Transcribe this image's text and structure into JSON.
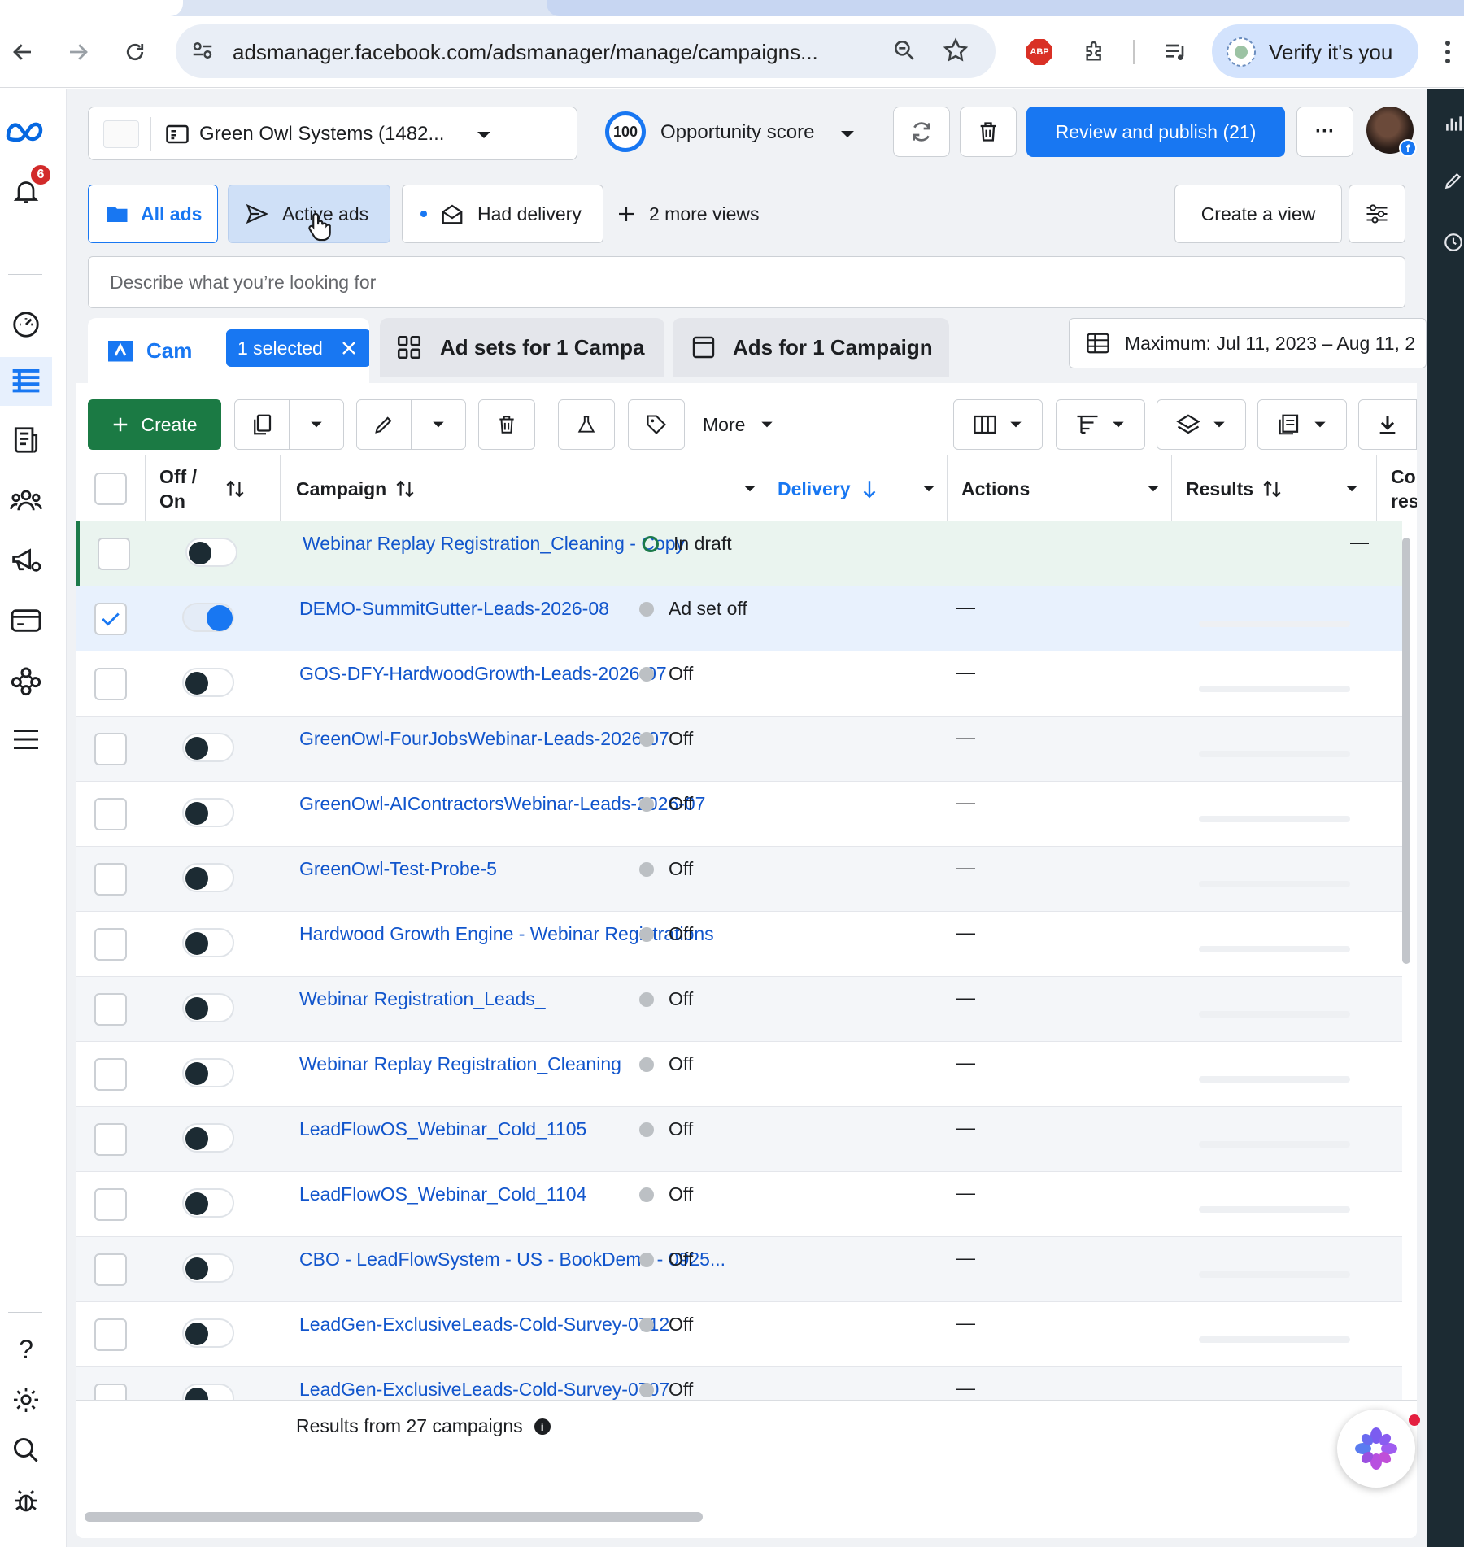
{
  "browser": {
    "url": "adsmanager.facebook.com/adsmanager/manage/campaigns...",
    "verify_label": "Verify it's you",
    "abp_label": "ABP"
  },
  "rail": {
    "notification_count": "6",
    "help_glyph": "?"
  },
  "header": {
    "account_name": "Green Owl Systems (1482...",
    "opportunity_score": "100",
    "opportunity_label": "Opportunity score",
    "publish_label": "Review and publish (21)",
    "more_glyph": "···"
  },
  "views": {
    "all_ads": "All ads",
    "active_ads": "Active ads",
    "had_delivery": "Had delivery",
    "more_views": "2 more views",
    "create_view": "Create a view"
  },
  "search": {
    "placeholder": "Describe what you’re looking for"
  },
  "tabs": {
    "campaigns": "Cam",
    "selected_chip": "1 selected",
    "adsets": "Ad sets for 1 Campa",
    "ads": "Ads for 1 Campaign",
    "date_range": "Maximum: Jul 11, 2023 – Aug 11, 2"
  },
  "actions": {
    "create_label": "Create",
    "more_label": "More"
  },
  "table": {
    "headers": {
      "offon_line1": "Off /",
      "offon_line2": "On",
      "campaign": "Campaign",
      "delivery": "Delivery",
      "actions": "Actions",
      "results": "Results",
      "cost_line1": "Co",
      "cost_line2": "res"
    },
    "rows": [
      {
        "name": "Webinar Replay Registration_Cleaning - Copy",
        "delivery": "In draft",
        "actions": "",
        "results": "—",
        "state": "draft",
        "on": false,
        "checked": false
      },
      {
        "name": "DEMO-SummitGutter-Leads-2026-08",
        "delivery": "Ad set off",
        "actions": "—",
        "results": "",
        "state": "selected",
        "on": true,
        "checked": true
      },
      {
        "name": "GOS-DFY-HardwoodGrowth-Leads-2026-07",
        "delivery": "Off",
        "actions": "—",
        "results": "",
        "state": "normal",
        "on": false,
        "checked": false
      },
      {
        "name": "GreenOwl-FourJobsWebinar-Leads-2026-07",
        "delivery": "Off",
        "actions": "—",
        "results": "",
        "state": "alt",
        "on": false,
        "checked": false
      },
      {
        "name": "GreenOwl-AIContractorsWebinar-Leads-2026-07",
        "delivery": "Off",
        "actions": "—",
        "results": "",
        "state": "normal",
        "on": false,
        "checked": false
      },
      {
        "name": "GreenOwl-Test-Probe-5",
        "delivery": "Off",
        "actions": "—",
        "results": "",
        "state": "alt",
        "on": false,
        "checked": false
      },
      {
        "name": "Hardwood Growth Engine - Webinar Registrations",
        "delivery": "Off",
        "actions": "—",
        "results": "",
        "state": "normal",
        "on": false,
        "checked": false
      },
      {
        "name": "Webinar Registration_Leads_",
        "delivery": "Off",
        "actions": "—",
        "results": "",
        "state": "alt",
        "on": false,
        "checked": false
      },
      {
        "name": "Webinar Replay Registration_Cleaning",
        "delivery": "Off",
        "actions": "—",
        "results": "",
        "state": "normal",
        "on": false,
        "checked": false
      },
      {
        "name": "LeadFlowOS_Webinar_Cold_1105",
        "delivery": "Off",
        "actions": "—",
        "results": "",
        "state": "alt",
        "on": false,
        "checked": false
      },
      {
        "name": "LeadFlowOS_Webinar_Cold_1104",
        "delivery": "Off",
        "actions": "—",
        "results": "",
        "state": "normal",
        "on": false,
        "checked": false
      },
      {
        "name": "CBO - LeadFlowSystem - US - BookDemo - 0925...",
        "delivery": "Off",
        "actions": "—",
        "results": "",
        "state": "alt",
        "on": false,
        "checked": false
      },
      {
        "name": "LeadGen-ExclusiveLeads-Cold-Survey-0712",
        "delivery": "Off",
        "actions": "—",
        "results": "",
        "state": "normal",
        "on": false,
        "checked": false
      },
      {
        "name": "LeadGen-ExclusiveLeads-Cold-Survey-0707",
        "delivery": "Off",
        "actions": "—",
        "results": "",
        "state": "alt",
        "on": false,
        "checked": false
      }
    ]
  },
  "footer": {
    "results_label": "Results from 27 campaigns",
    "info_glyph": "i"
  },
  "colors": {
    "brand_blue": "#1877f2",
    "link_blue": "#1155cc",
    "create_green": "#1b7a44",
    "notification_red": "#d22a2a"
  }
}
